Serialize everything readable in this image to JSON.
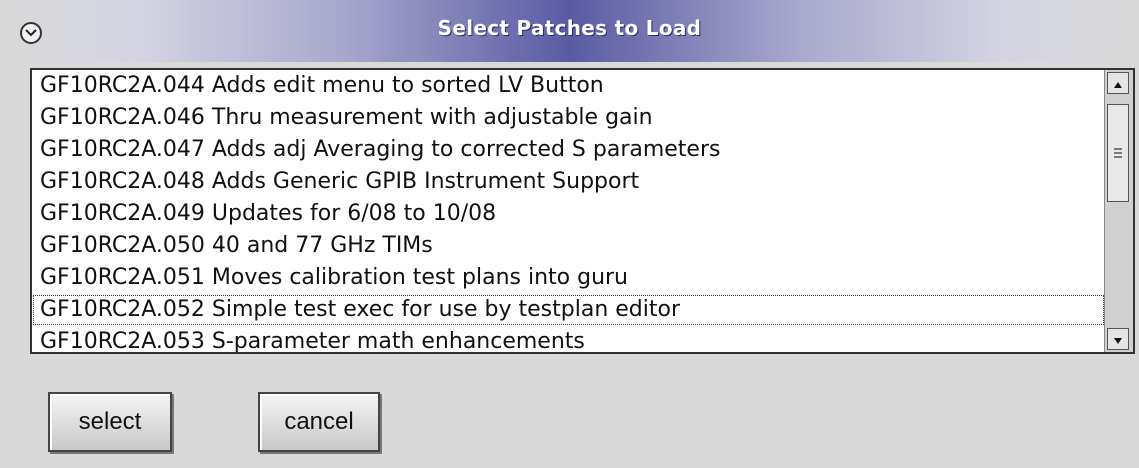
{
  "window": {
    "title": "Select Patches to Load"
  },
  "patch_list": {
    "focused_index": 7,
    "items": [
      "GF10RC2A.044 Adds edit menu to sorted LV Button",
      "GF10RC2A.046 Thru measurement with adjustable gain",
      "GF10RC2A.047 Adds adj Averaging to corrected S parameters",
      "GF10RC2A.048 Adds Generic GPIB Instrument Support",
      "GF10RC2A.049 Updates for 6/08 to 10/08",
      "GF10RC2A.050 40 and 77 GHz TIMs",
      "GF10RC2A.051 Moves calibration test plans into guru",
      "GF10RC2A.052 Simple test exec for use by testplan editor",
      "GF10RC2A.053 S-parameter math enhancements"
    ]
  },
  "buttons": {
    "select_label": "select",
    "cancel_label": "cancel"
  },
  "icons": {
    "window_menu": "chevron-down-circle-icon",
    "scroll_up": "triangle-up-icon",
    "scroll_down": "triangle-down-icon",
    "scroll_thumb_grip": "grip-lines-icon"
  },
  "colors": {
    "title_bar_center": "#5a5aa4",
    "background": "#d9d9d9"
  }
}
